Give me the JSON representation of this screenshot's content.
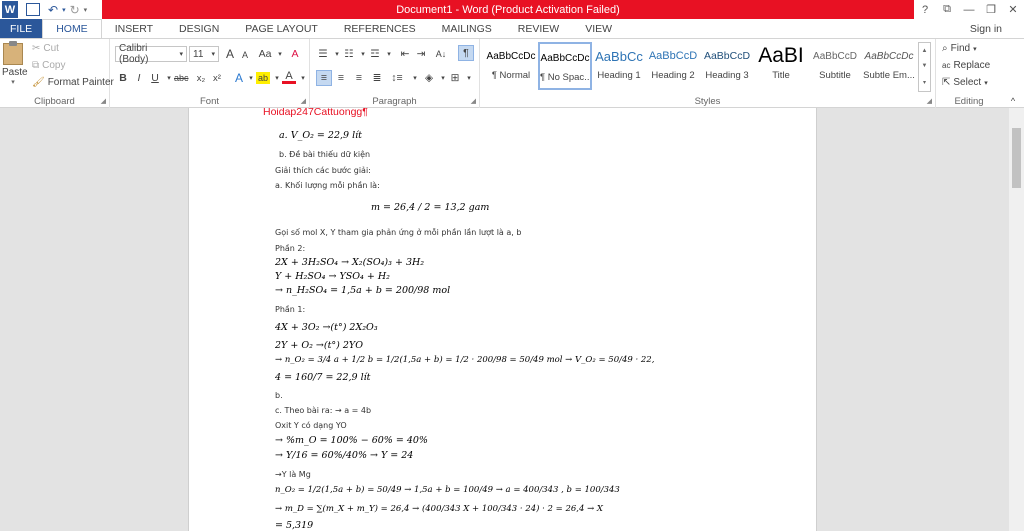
{
  "app": {
    "title": "Document1 - Word (Product Activation Failed)",
    "icons": {
      "help": "?",
      "ribbon_display": "⧉",
      "minimize": "—",
      "restore": "❐",
      "close": "✕"
    }
  },
  "qat": {
    "undo": "↶",
    "redo": "↻"
  },
  "tabs": [
    "FILE",
    "HOME",
    "INSERT",
    "DESIGN",
    "PAGE LAYOUT",
    "REFERENCES",
    "MAILINGS",
    "REVIEW",
    "VIEW"
  ],
  "signin": "Sign in",
  "clipboard": {
    "paste": "Paste",
    "cut": "Cut",
    "copy": "Copy",
    "format_painter": "Format Painter",
    "label": "Clipboard"
  },
  "font": {
    "name": "Calibri (Body)",
    "size": "11",
    "label": "Font",
    "grow": "A",
    "shrink": "A",
    "case": "Aa",
    "clear": "A",
    "bold": "B",
    "italic": "I",
    "underline": "U",
    "strike": "abc",
    "sub": "x₂",
    "sup": "x²",
    "effects": "A",
    "highlight": "ab",
    "color": "A"
  },
  "paragraph": {
    "label": "Paragraph",
    "pilcrow": "¶"
  },
  "styles": {
    "label": "Styles",
    "items": [
      {
        "preview": "AaBbCcDc",
        "name": "¶ Normal"
      },
      {
        "preview": "AaBbCcDc",
        "name": "¶ No Spac..."
      },
      {
        "preview": "AaBbCc",
        "name": "Heading 1"
      },
      {
        "preview": "AaBbCcD",
        "name": "Heading 2"
      },
      {
        "preview": "AaBbCcD",
        "name": "Heading 3"
      },
      {
        "preview": "AaBI",
        "name": "Title"
      },
      {
        "preview": "AaBbCcD",
        "name": "Subtitle"
      },
      {
        "preview": "AaBbCcDc",
        "name": "Subtle Em..."
      }
    ]
  },
  "editing": {
    "find": "Find",
    "replace": "Replace",
    "select": "Select",
    "label": "Editing"
  },
  "colors": {
    "accent": "#2b579a",
    "title_bar": "#e81123",
    "heading_text": "#e81123"
  },
  "document": {
    "heading": "Hoidap247Cattuongg¶",
    "lines": [
      "a. V_O₂ = 22,9 lít",
      "b. Đề bài thiếu dữ kiện",
      "Giải thích các bước giải:",
      "a. Khối lượng mỗi phần là:",
      "m = 26,4 / 2 = 13,2 gam",
      "Gọi số mol X, Y tham gia phản ứng ở mỗi phần lần lượt là a, b",
      "Phần 2:",
      "2X + 3H₂SO₄ → X₂(SO₄)₃ + 3H₂",
      "Y + H₂SO₄ → YSO₄ + H₂",
      "→ n_H₂SO₄ = 1,5a + b = 200/98 mol",
      "Phần 1:",
      "4X + 3O₂ →(t°) 2X₂O₃",
      "2Y + O₂ →(t°) 2YO",
      "→ n_O₂ = 3/4 a + 1/2 b = 1/2(1,5a + b) = 1/2 · 200/98 = 50/49 mol → V_O₂ = 50/49 · 22,",
      "4 = 160/7 = 22,9 lít",
      "b.",
      "c. Theo bài ra: → a = 4b",
      "Oxit Y có dạng YO",
      "→ %m_O = 100% − 60% = 40%",
      "→ Y/16 = 60%/40% → Y = 24",
      "→Y là Mg",
      "n_O₂ = 1/2(1,5a + b) = 50/49 → 1,5a + b = 100/49 → a = 400/343 , b = 100/343",
      "→ m_D = ∑(m_X + m_Y) = 26,4 → (400/343 X + 100/343 · 24) · 2 = 26,4 → X",
      "= 5,319"
    ]
  }
}
